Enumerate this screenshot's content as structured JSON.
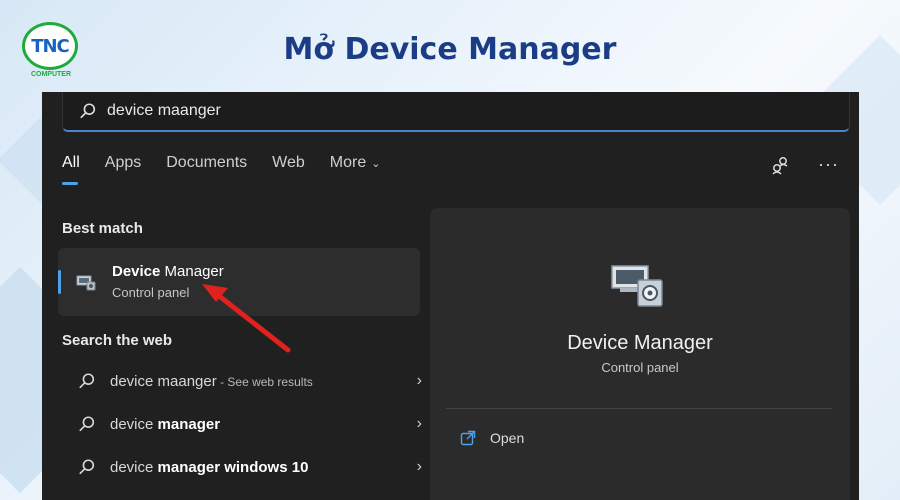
{
  "header": {
    "logo_text": "TNC",
    "logo_sub": "COMPUTER",
    "title": "Mở Device Manager"
  },
  "search": {
    "query": "device maanger",
    "icon": "search-icon"
  },
  "tabs": [
    {
      "label": "All",
      "active": true
    },
    {
      "label": "Apps",
      "active": false
    },
    {
      "label": "Documents",
      "active": false
    },
    {
      "label": "Web",
      "active": false
    },
    {
      "label": "More",
      "active": false
    }
  ],
  "toolbar": {
    "share_icon": "share-icon",
    "more_label": "···"
  },
  "best_match": {
    "section_label": "Best match",
    "title_bold": "Device",
    "title_rest": " Manager",
    "subtitle": "Control panel"
  },
  "web_search": {
    "section_label": "Search the web",
    "results": [
      {
        "prefix": "device maanger",
        "bold": "",
        "suffix": " - See web results"
      },
      {
        "prefix": "device ",
        "bold": "manager",
        "suffix": ""
      },
      {
        "prefix": "device ",
        "bold": "manager windows 10",
        "suffix": ""
      }
    ]
  },
  "detail": {
    "title": "Device Manager",
    "subtitle": "Control panel",
    "open_label": "Open"
  },
  "colors": {
    "accent": "#4ea0e8",
    "title_blue": "#1b3d86",
    "arrow_red": "#e0221e",
    "logo_green": "#1faa3c"
  }
}
